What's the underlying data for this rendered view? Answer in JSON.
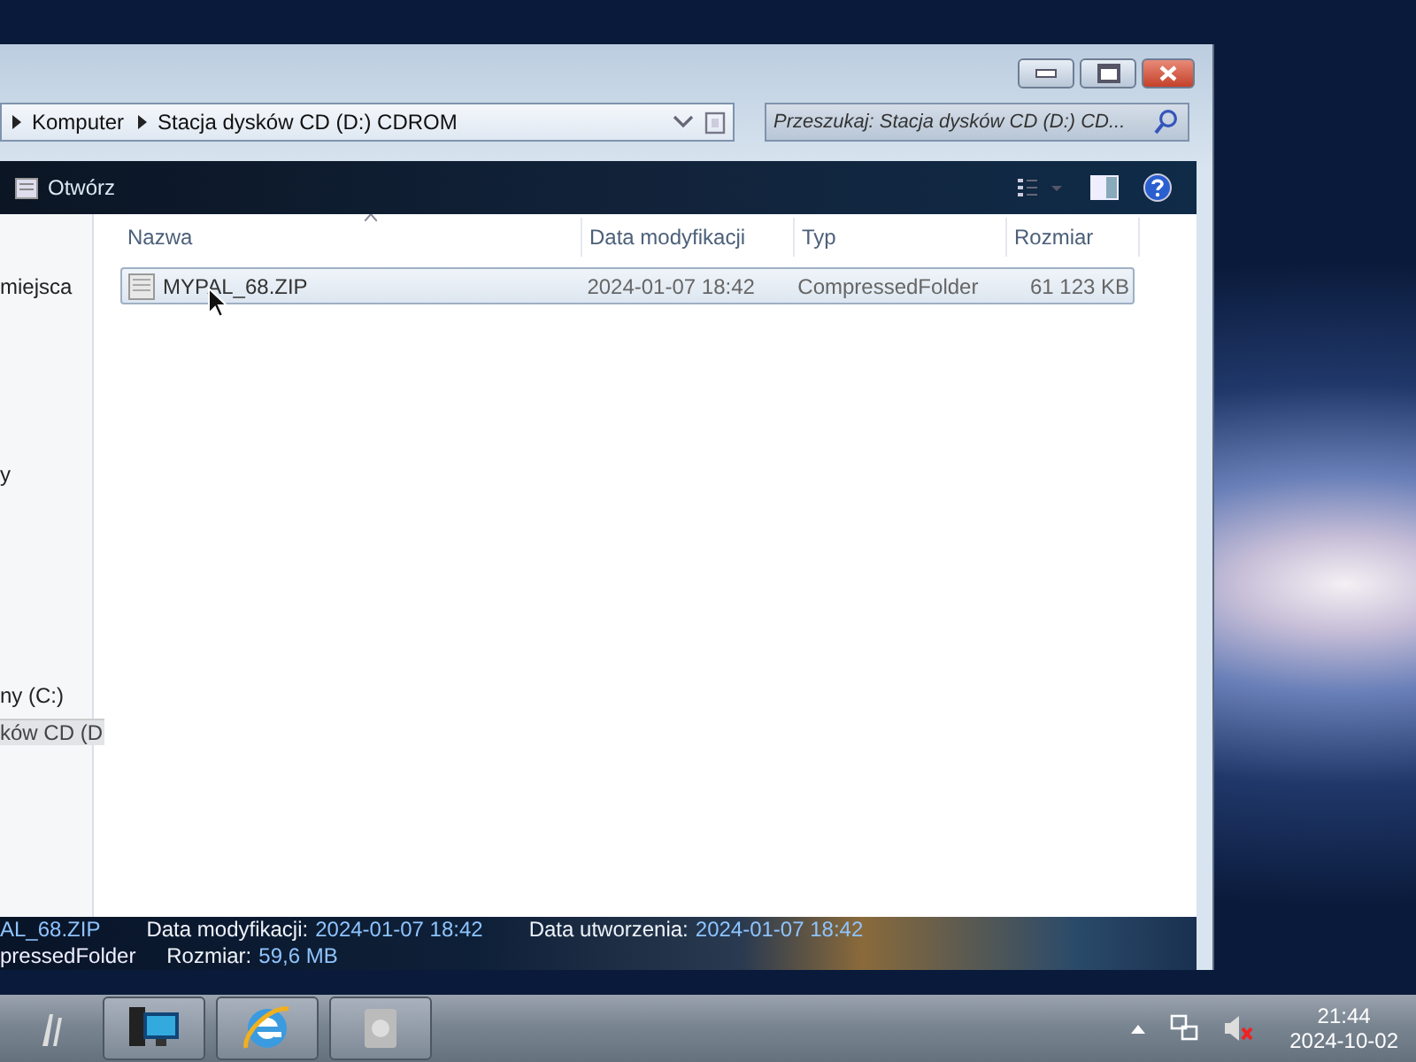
{
  "window": {
    "breadcrumb": [
      "Komputer",
      "Stacja dysków CD (D:) CDROM"
    ],
    "search": {
      "placeholder": "Przeszukaj: Stacja dysków CD (D:) CD..."
    },
    "toolbar": {
      "open_label": "Otwórz"
    },
    "sidebar": {
      "items": [
        {
          "label": "miejsca",
          "selected": false
        },
        {
          "label": "y",
          "selected": false
        },
        {
          "label": "ny (C:)",
          "selected": false
        },
        {
          "label": "ków CD (D",
          "selected": true
        }
      ]
    },
    "table": {
      "columns": [
        "Nazwa",
        "Data modyfikacji",
        "Typ",
        "Rozmiar"
      ],
      "rows": [
        {
          "name": "MYPAL_68.ZIP",
          "modified": "2024-01-07 18:42",
          "type": "CompressedFolder",
          "size": "61 123 KB",
          "selected": true
        }
      ]
    },
    "details": {
      "name": "AL_68.ZIP",
      "type": "pressedFolder",
      "fields": [
        {
          "label": "Data modyfikacji:",
          "value": "2024-01-07 18:42"
        },
        {
          "label": "Data utworzenia:",
          "value": "2024-01-07 18:42"
        },
        {
          "label": "Rozmiar:",
          "value": "59,6 MB"
        }
      ]
    }
  },
  "taskbar": {
    "time": "21:44",
    "date": "2024-10-02"
  }
}
